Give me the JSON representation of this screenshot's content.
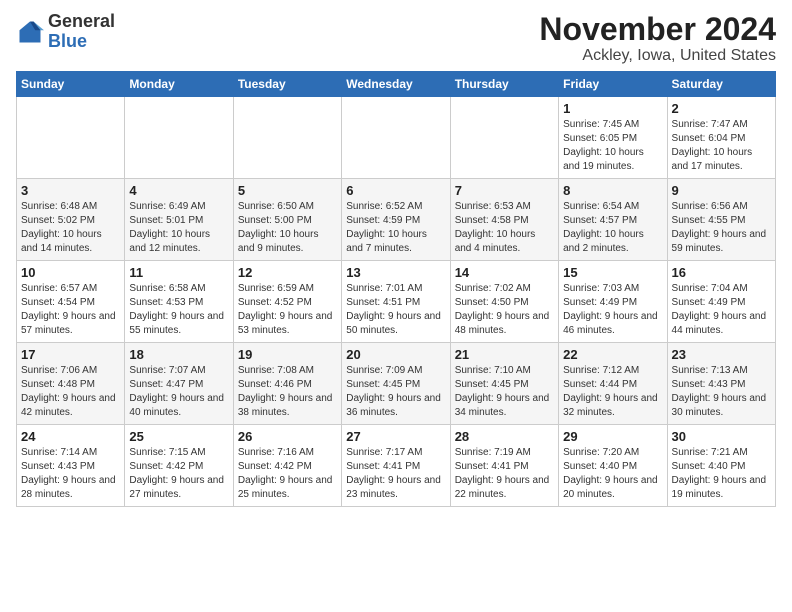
{
  "logo": {
    "general": "General",
    "blue": "Blue"
  },
  "header": {
    "month": "November 2024",
    "location": "Ackley, Iowa, United States"
  },
  "weekdays": [
    "Sunday",
    "Monday",
    "Tuesday",
    "Wednesday",
    "Thursday",
    "Friday",
    "Saturday"
  ],
  "weeks": [
    [
      {
        "day": "",
        "info": ""
      },
      {
        "day": "",
        "info": ""
      },
      {
        "day": "",
        "info": ""
      },
      {
        "day": "",
        "info": ""
      },
      {
        "day": "",
        "info": ""
      },
      {
        "day": "1",
        "info": "Sunrise: 7:45 AM\nSunset: 6:05 PM\nDaylight: 10 hours and 19 minutes."
      },
      {
        "day": "2",
        "info": "Sunrise: 7:47 AM\nSunset: 6:04 PM\nDaylight: 10 hours and 17 minutes."
      }
    ],
    [
      {
        "day": "3",
        "info": "Sunrise: 6:48 AM\nSunset: 5:02 PM\nDaylight: 10 hours and 14 minutes."
      },
      {
        "day": "4",
        "info": "Sunrise: 6:49 AM\nSunset: 5:01 PM\nDaylight: 10 hours and 12 minutes."
      },
      {
        "day": "5",
        "info": "Sunrise: 6:50 AM\nSunset: 5:00 PM\nDaylight: 10 hours and 9 minutes."
      },
      {
        "day": "6",
        "info": "Sunrise: 6:52 AM\nSunset: 4:59 PM\nDaylight: 10 hours and 7 minutes."
      },
      {
        "day": "7",
        "info": "Sunrise: 6:53 AM\nSunset: 4:58 PM\nDaylight: 10 hours and 4 minutes."
      },
      {
        "day": "8",
        "info": "Sunrise: 6:54 AM\nSunset: 4:57 PM\nDaylight: 10 hours and 2 minutes."
      },
      {
        "day": "9",
        "info": "Sunrise: 6:56 AM\nSunset: 4:55 PM\nDaylight: 9 hours and 59 minutes."
      }
    ],
    [
      {
        "day": "10",
        "info": "Sunrise: 6:57 AM\nSunset: 4:54 PM\nDaylight: 9 hours and 57 minutes."
      },
      {
        "day": "11",
        "info": "Sunrise: 6:58 AM\nSunset: 4:53 PM\nDaylight: 9 hours and 55 minutes."
      },
      {
        "day": "12",
        "info": "Sunrise: 6:59 AM\nSunset: 4:52 PM\nDaylight: 9 hours and 53 minutes."
      },
      {
        "day": "13",
        "info": "Sunrise: 7:01 AM\nSunset: 4:51 PM\nDaylight: 9 hours and 50 minutes."
      },
      {
        "day": "14",
        "info": "Sunrise: 7:02 AM\nSunset: 4:50 PM\nDaylight: 9 hours and 48 minutes."
      },
      {
        "day": "15",
        "info": "Sunrise: 7:03 AM\nSunset: 4:49 PM\nDaylight: 9 hours and 46 minutes."
      },
      {
        "day": "16",
        "info": "Sunrise: 7:04 AM\nSunset: 4:49 PM\nDaylight: 9 hours and 44 minutes."
      }
    ],
    [
      {
        "day": "17",
        "info": "Sunrise: 7:06 AM\nSunset: 4:48 PM\nDaylight: 9 hours and 42 minutes."
      },
      {
        "day": "18",
        "info": "Sunrise: 7:07 AM\nSunset: 4:47 PM\nDaylight: 9 hours and 40 minutes."
      },
      {
        "day": "19",
        "info": "Sunrise: 7:08 AM\nSunset: 4:46 PM\nDaylight: 9 hours and 38 minutes."
      },
      {
        "day": "20",
        "info": "Sunrise: 7:09 AM\nSunset: 4:45 PM\nDaylight: 9 hours and 36 minutes."
      },
      {
        "day": "21",
        "info": "Sunrise: 7:10 AM\nSunset: 4:45 PM\nDaylight: 9 hours and 34 minutes."
      },
      {
        "day": "22",
        "info": "Sunrise: 7:12 AM\nSunset: 4:44 PM\nDaylight: 9 hours and 32 minutes."
      },
      {
        "day": "23",
        "info": "Sunrise: 7:13 AM\nSunset: 4:43 PM\nDaylight: 9 hours and 30 minutes."
      }
    ],
    [
      {
        "day": "24",
        "info": "Sunrise: 7:14 AM\nSunset: 4:43 PM\nDaylight: 9 hours and 28 minutes."
      },
      {
        "day": "25",
        "info": "Sunrise: 7:15 AM\nSunset: 4:42 PM\nDaylight: 9 hours and 27 minutes."
      },
      {
        "day": "26",
        "info": "Sunrise: 7:16 AM\nSunset: 4:42 PM\nDaylight: 9 hours and 25 minutes."
      },
      {
        "day": "27",
        "info": "Sunrise: 7:17 AM\nSunset: 4:41 PM\nDaylight: 9 hours and 23 minutes."
      },
      {
        "day": "28",
        "info": "Sunrise: 7:19 AM\nSunset: 4:41 PM\nDaylight: 9 hours and 22 minutes."
      },
      {
        "day": "29",
        "info": "Sunrise: 7:20 AM\nSunset: 4:40 PM\nDaylight: 9 hours and 20 minutes."
      },
      {
        "day": "30",
        "info": "Sunrise: 7:21 AM\nSunset: 4:40 PM\nDaylight: 9 hours and 19 minutes."
      }
    ]
  ]
}
